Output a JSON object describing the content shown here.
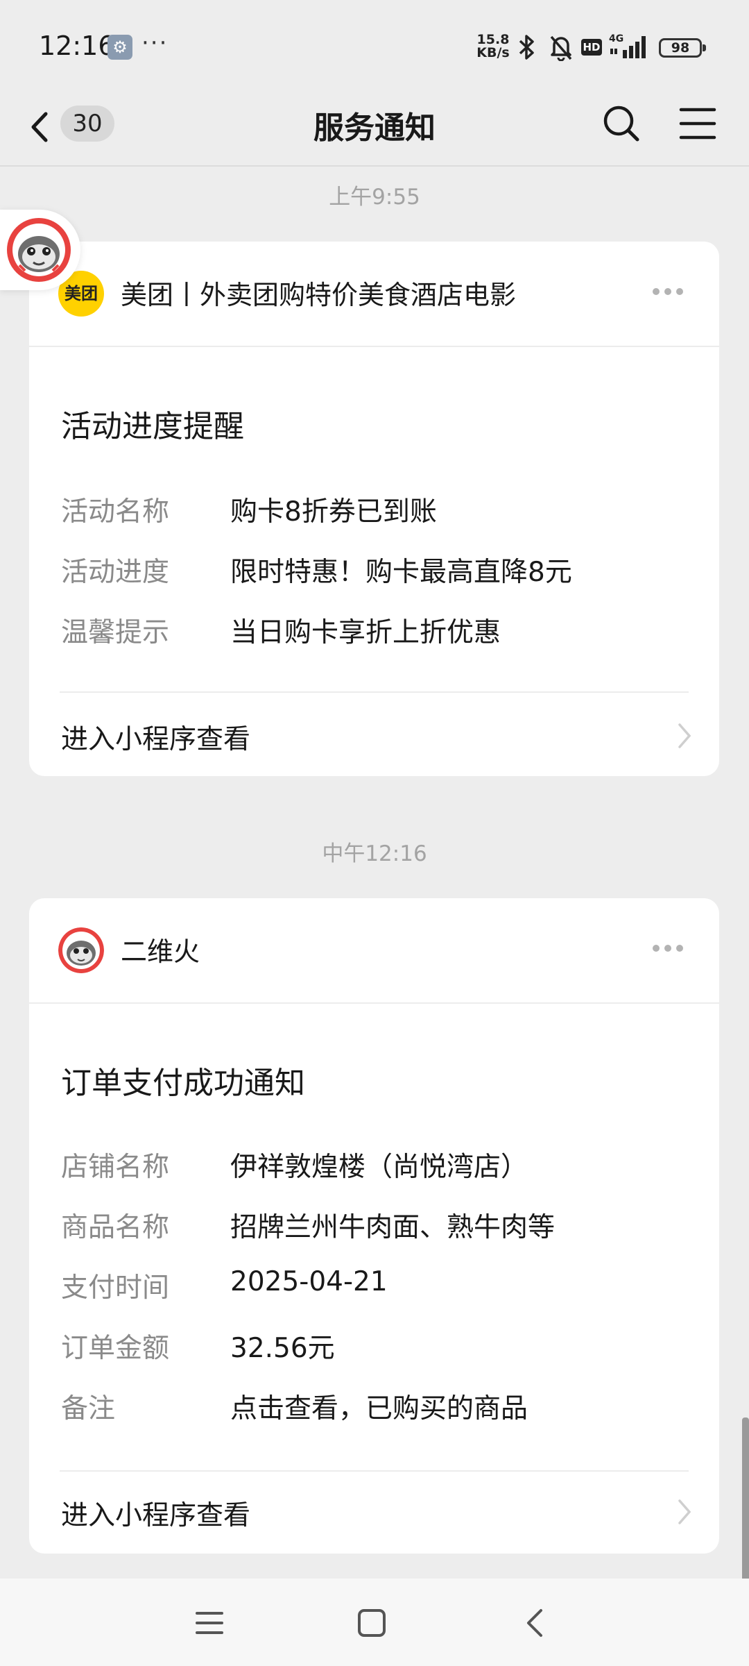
{
  "status_bar": {
    "time": "12:16",
    "more": "···",
    "net_speed_value": "15.8",
    "net_speed_unit": "KB/s",
    "hd": "HD",
    "signal": "4G",
    "battery": "98"
  },
  "nav": {
    "unread_count": "30",
    "title": "服务通知"
  },
  "messages": [
    {
      "timestamp": "上午9:55",
      "source": "美团丨外卖团购特价美食酒店电影",
      "logo_text": "美团",
      "title": "活动进度提醒",
      "rows": [
        {
          "label": "活动名称",
          "value": "购卡8折券已到账"
        },
        {
          "label": "活动进度",
          "value": "限时特惠！购卡最高直降8元"
        },
        {
          "label": "温馨提示",
          "value": "当日购卡享折上折优惠"
        }
      ],
      "link": "进入小程序查看"
    },
    {
      "timestamp": "中午12:16",
      "source": "二维火",
      "title": "订单支付成功通知",
      "rows": [
        {
          "label": "店铺名称",
          "value": "伊祥敦煌楼（尚悦湾店）"
        },
        {
          "label": "商品名称",
          "value": "招牌兰州牛肉面、熟牛肉等"
        },
        {
          "label": "支付时间",
          "value": "2025-04-21"
        },
        {
          "label": "订单金额",
          "value": "32.56元"
        },
        {
          "label": "备注",
          "value": "点击查看，已购买的商品"
        }
      ],
      "link": "进入小程序查看"
    }
  ],
  "colors": {
    "background": "#ededed",
    "card": "#ffffff",
    "meituan_yellow": "#ffd100",
    "erweihuo_red": "#e8423f",
    "label_gray": "#8a8a8a"
  }
}
